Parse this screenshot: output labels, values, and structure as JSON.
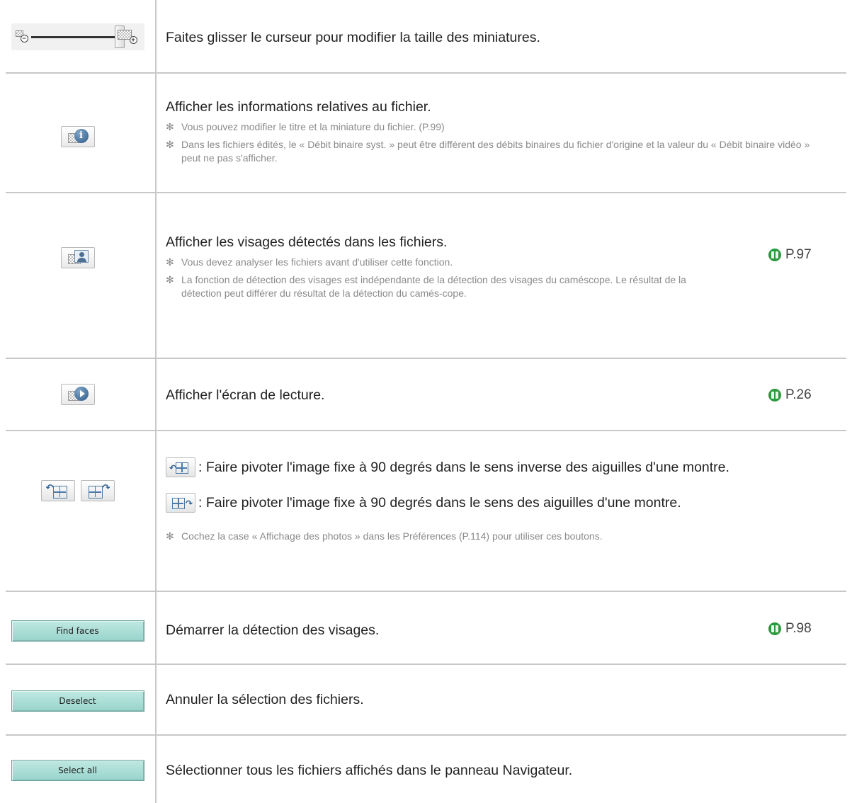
{
  "rows": [
    {
      "id": "zoom",
      "text": "Faites glisser le curseur pour modifier la taille des miniatures."
    },
    {
      "id": "info",
      "text": "Afficher les informations relatives au fichier.",
      "notes": [
        "Vous pouvez modifier le titre et la miniature du fichier. (P.99)",
        "Dans les fichiers édités, le « Débit binaire syst. » peut être différent des débits binaires du fichier d'origine et la valeur du « Débit binaire vidéo » peut ne pas s'afficher."
      ]
    },
    {
      "id": "faces",
      "text": "Afficher les visages détectés dans les fichiers.",
      "notes": [
        "Vous devez analyser les fichiers avant d'utiliser cette fonction.",
        "La fonction de détection des visages est indépendante de la détection des visages du caméscope. Le résultat de la détection peut différer du résultat de la détection du camés-cope."
      ],
      "ref": "P.97"
    },
    {
      "id": "playback",
      "text": "Afficher l'écran de lecture.",
      "ref": "P.26"
    },
    {
      "id": "rotate",
      "ccw_text": ": Faire pivoter l'image fixe à 90 degrés dans le sens inverse des aiguilles d'une montre.",
      "cw_text": ": Faire pivoter l'image fixe à 90 degrés dans le sens des aiguilles d'une montre.",
      "note": "Cochez la case « Affichage des photos » dans les Préférences (P.114) pour utiliser ces boutons."
    },
    {
      "id": "find",
      "button": "Find faces",
      "text": "Démarrer la détection des visages.",
      "ref": "P.98"
    },
    {
      "id": "deselect",
      "button": "Deselect",
      "text": "Annuler la sélection des fichiers."
    },
    {
      "id": "selectall",
      "button": "Select all",
      "text": "Sélectionner tous les fichiers affichés dans le panneau Navigateur."
    }
  ],
  "note_marker": "✻",
  "icons": {
    "zoom": [
      "zoom-out-icon",
      "zoom-in-icon"
    ],
    "info": "file-info-icon",
    "faces": "face-detect-icon",
    "playback": "playback-icon",
    "rotate": [
      "rotate-ccw-icon",
      "rotate-cw-icon"
    ],
    "ref": "book-icon"
  },
  "colors": {
    "divider": "#c8c8c8",
    "note_text": "#8a8a8a",
    "ref_icon": "#2c9a3c",
    "button_fill": "#a8dcd4"
  }
}
